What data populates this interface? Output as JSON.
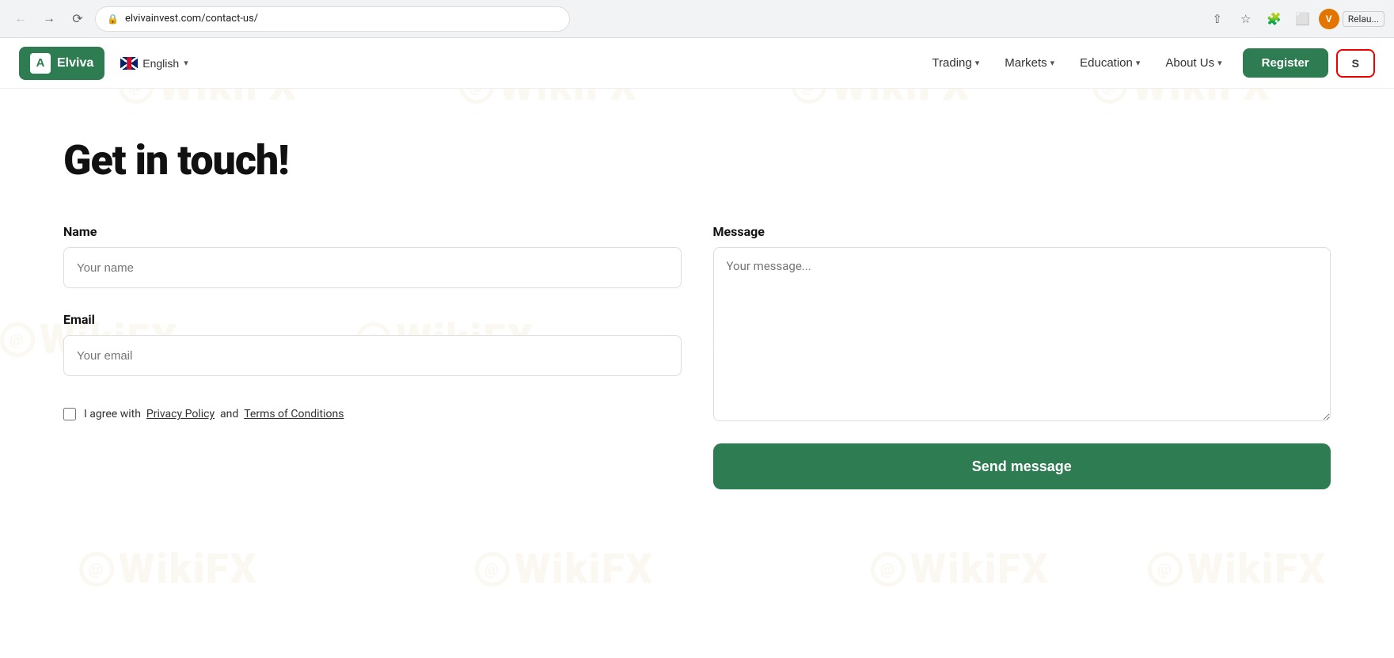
{
  "browser": {
    "url": "elvivainvest.com/contact-us/",
    "profile_initial": "V",
    "extension_label": "Relau..."
  },
  "nav": {
    "logo_letter": "A",
    "logo_name": "Elviva",
    "language": "English",
    "menu_items": [
      {
        "label": "Trading",
        "has_dropdown": true
      },
      {
        "label": "Markets",
        "has_dropdown": true
      },
      {
        "label": "Education",
        "has_dropdown": true
      },
      {
        "label": "About Us",
        "has_dropdown": true
      }
    ],
    "register_label": "Register",
    "signin_label": "S"
  },
  "page": {
    "title": "Get in touch!",
    "form": {
      "name_label": "Name",
      "name_placeholder": "Your name",
      "email_label": "Email",
      "email_placeholder": "Your email",
      "message_label": "Message",
      "message_placeholder": "Your message...",
      "checkbox_text": "I agree with",
      "privacy_link": "Privacy Policy",
      "and_text": "and",
      "terms_link": "Terms of Conditions",
      "send_label": "Send message"
    }
  },
  "watermark": {
    "text": "WikiFX"
  }
}
